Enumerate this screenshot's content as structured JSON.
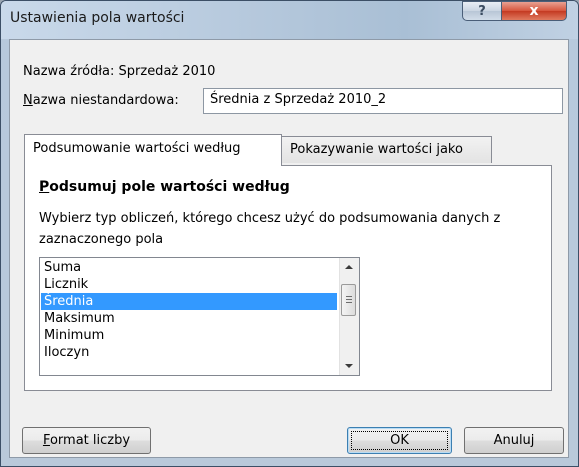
{
  "window": {
    "title": "Ustawienia pola wartości",
    "help_label": "?",
    "close_label": "x"
  },
  "source": {
    "label": "Nazwa źródła:",
    "value": "Sprzedaż 2010"
  },
  "custom_name": {
    "label_access_key": "N",
    "label_rest": "azwa niestandardowa:",
    "value": "Średnia z Sprzedaż 2010_2"
  },
  "tabs": [
    {
      "label": "Podsumowanie wartości według",
      "active": true
    },
    {
      "label": "Pokazywanie wartości jako",
      "active": false
    }
  ],
  "summarize": {
    "section_title_access_key": "P",
    "section_title_rest": "odsumuj pole wartości według",
    "description": "Wybierz typ obliczeń, którego chcesz użyć do podsumowania danych z zaznaczonego pola",
    "items": [
      "Suma",
      "Licznik",
      "Średnia",
      "Maksimum",
      "Minimum",
      "Iloczyn"
    ],
    "selected": "Średnia"
  },
  "buttons": {
    "format_access_key": "F",
    "format_rest": "ormat liczby",
    "ok": "OK",
    "cancel": "Anuluj"
  }
}
